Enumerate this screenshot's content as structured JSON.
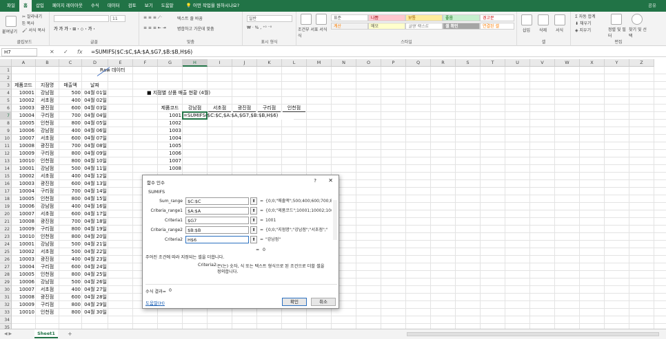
{
  "menu": {
    "items": [
      "파일",
      "홈",
      "삽입",
      "페이지 레이아웃",
      "수식",
      "데이터",
      "검토",
      "보기",
      "도움말"
    ],
    "search": "어떤 작업을 원하시나요?",
    "share": "공유"
  },
  "ribbon": {
    "clipboard": {
      "label": "클립보드",
      "paste": "붙여넣기",
      "cut": "잘라내기",
      "copy": "복사",
      "format_painter": "서식 복사"
    },
    "font": {
      "label": "글꼴",
      "size": "11"
    },
    "align": {
      "label": "맞춤",
      "wrap": "텍스트 줄 바꿈",
      "merge": "병합하고 가운데 맞춤"
    },
    "number": {
      "label": "표시 형식",
      "format": "일반"
    },
    "styles": {
      "label": "스타일",
      "cond": "조건부 서식",
      "table": "표 서식",
      "normal": "표준",
      "bad": "나쁨",
      "neutral": "보통",
      "good": "좋음",
      "warn": "경고문",
      "calc": "계산",
      "memo": "메모",
      "explain": "설명 텍스트",
      "check": "셀 확인",
      "linked": "연결된 셀"
    },
    "cells": {
      "label": "셀",
      "insert": "삽입",
      "delete": "삭제",
      "format": "서식"
    },
    "edit": {
      "label": "편집",
      "autosum": "자동 합계",
      "fill": "채우기",
      "clear": "지우기",
      "sort": "정렬 및 필터",
      "find": "찾기 및 선택"
    }
  },
  "formula": {
    "name": "H7",
    "text": "=SUMIFS($C:$C,$A:$A,$G7,$B:$B,H$6)"
  },
  "columns": [
    "A",
    "B",
    "C",
    "D",
    "E",
    "F",
    "G",
    "H",
    "I",
    "J",
    "K",
    "L",
    "M",
    "N",
    "O",
    "P",
    "Q",
    "R",
    "S",
    "T",
    "U",
    "V",
    "W",
    "X",
    "Y",
    "Z"
  ],
  "rows": [
    "1",
    "2",
    "3",
    "4",
    "5",
    "6",
    "7",
    "8",
    "9",
    "10",
    "11",
    "12",
    "13",
    "14",
    "15",
    "16",
    "17",
    "18",
    "19",
    "20",
    "21",
    "22",
    "23",
    "24",
    "25",
    "26",
    "27",
    "28",
    "29",
    "30",
    "31",
    "32",
    "33",
    "34",
    "35"
  ],
  "sheet": {
    "raw_label": "Raw 데이터",
    "headers": [
      "제품코드",
      "지점명",
      "매출액",
      "날짜"
    ],
    "data": [
      [
        "10001",
        "강남점",
        "500",
        "04월 01일"
      ],
      [
        "10002",
        "서초점",
        "400",
        "04월 02일"
      ],
      [
        "10003",
        "광진점",
        "600",
        "04월 03일"
      ],
      [
        "10004",
        "구리점",
        "700",
        "04월 04일"
      ],
      [
        "10005",
        "인천점",
        "800",
        "04월 05일"
      ],
      [
        "10006",
        "강남점",
        "400",
        "04월 06일"
      ],
      [
        "10007",
        "서초점",
        "600",
        "04월 07일"
      ],
      [
        "10008",
        "광진점",
        "700",
        "04월 08일"
      ],
      [
        "10009",
        "구리점",
        "800",
        "04월 09일"
      ],
      [
        "10010",
        "인천점",
        "800",
        "04월 10일"
      ],
      [
        "10001",
        "강남점",
        "500",
        "04월 11일"
      ],
      [
        "10002",
        "서초점",
        "400",
        "04월 12일"
      ],
      [
        "10003",
        "광진점",
        "600",
        "04월 13일"
      ],
      [
        "10004",
        "구리점",
        "700",
        "04월 14일"
      ],
      [
        "10005",
        "인천점",
        "800",
        "04월 15일"
      ],
      [
        "10006",
        "강남점",
        "400",
        "04월 16일"
      ],
      [
        "10007",
        "서초점",
        "600",
        "04월 17일"
      ],
      [
        "10008",
        "광진점",
        "700",
        "04월 18일"
      ],
      [
        "10009",
        "구리점",
        "800",
        "04월 19일"
      ],
      [
        "10010",
        "인천점",
        "800",
        "04월 20일"
      ],
      [
        "10001",
        "강남점",
        "500",
        "04월 21일"
      ],
      [
        "10002",
        "서초점",
        "500",
        "04월 22일"
      ],
      [
        "10003",
        "광진점",
        "400",
        "04월 23일"
      ],
      [
        "10004",
        "구리점",
        "600",
        "04월 24일"
      ],
      [
        "10005",
        "인천점",
        "800",
        "04월 25일"
      ],
      [
        "10006",
        "강남점",
        "500",
        "04월 26일"
      ],
      [
        "10007",
        "서초점",
        "400",
        "04월 27일"
      ],
      [
        "10008",
        "광진점",
        "600",
        "04월 28일"
      ],
      [
        "10009",
        "구리점",
        "800",
        "04월 29일"
      ],
      [
        "10010",
        "인천점",
        "800",
        "04월 30일"
      ]
    ],
    "report_title": "■ 지점별 상품 매출 현황 (4월)",
    "report_header": [
      "제품코드",
      "강남점",
      "서초점",
      "광진점",
      "구리점",
      "인천점"
    ],
    "report_codes": [
      "1001",
      "1002",
      "1003",
      "1004",
      "1005",
      "1006",
      "1007",
      "1008"
    ],
    "active_formula": "=SUMIFS($C:$C,$A:$A,$G7,$B:$B,H$6)"
  },
  "dialog": {
    "title": "함수 인수",
    "help": "?",
    "close": "✕",
    "function": "SUMIFS",
    "args": [
      {
        "label": "Sum_range",
        "value": "$C:$C",
        "result": "{0;0;\"매출액\";500;400;600;700;80"
      },
      {
        "label": "Criteria_range1",
        "value": "$A:$A",
        "result": "{0;0;\"제품코드\";10001;10002;10("
      },
      {
        "label": "Criteria1",
        "value": "$G7",
        "result": "1001"
      },
      {
        "label": "Criteria_range2",
        "value": "$B:$B",
        "result": "{0;0;\"지점명\";\"강남점\";\"서초점\";\""
      },
      {
        "label": "Criteria2",
        "value": "H$6",
        "result": "\"강남점\""
      }
    ],
    "eq": "=",
    "total": "0",
    "description": "주어진 조건에 따라 지정되는 셀을 더합니다.",
    "arg_name": "Criteria2:",
    "arg_desc1": "은(는) 숫자, 식 또는 텍스트 형식으로 된 조건으로 더할 셀을",
    "arg_desc2": "정의합니다.",
    "result_label": "수식 결과=",
    "result_value": "0",
    "help_link": "도움말(H)",
    "ok": "확인",
    "cancel": "취소"
  },
  "bottom": {
    "sheet_tab": "Sheet1",
    "add": "+"
  }
}
